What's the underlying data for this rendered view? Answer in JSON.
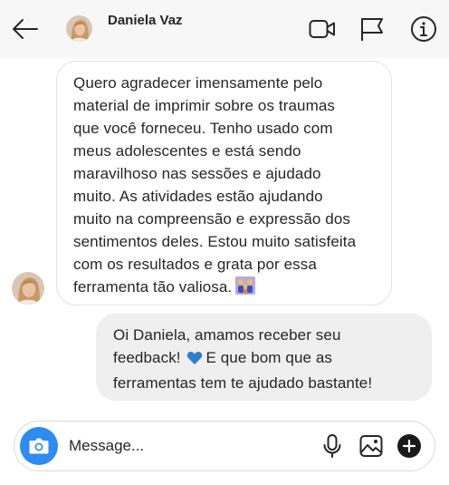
{
  "header": {
    "contact_name": "Daniela Vaz",
    "icons": [
      "back-arrow-icon",
      "video-call-icon",
      "flag-icon",
      "info-icon"
    ]
  },
  "messages": [
    {
      "direction": "incoming",
      "lines": [
        "Quero agradecer imensamente pelo",
        "material de imprimir sobre os traumas",
        "que você forneceu. Tenho usado com",
        "meus adolescentes e está sendo",
        "maravilhoso nas sessões e ajudado",
        "muito. As atividades estão ajudando",
        "muito na compreensão e expressão dos",
        "sentimentos deles. Estou muito satisfeita",
        "com os resultados e grata por essa",
        "ferramenta tão valiosa."
      ],
      "emoji": "family-emoji"
    },
    {
      "direction": "outgoing",
      "lines": [
        "Oi Daniela, amamos receber seu",
        "feedback!",
        "E que bom que as",
        "ferramentas tem te ajudado bastante!"
      ],
      "emoji": "blue-heart-emoji"
    }
  ],
  "composer": {
    "placeholder": "Message...",
    "icons": [
      "camera-icon",
      "microphone-icon",
      "image-icon",
      "plus-icon"
    ]
  },
  "colors": {
    "header_bg": "#f7f7f7",
    "outgoing_bubble": "#efefef",
    "camera_button": "#2e8bf0",
    "heart": "#2f7fd1"
  }
}
